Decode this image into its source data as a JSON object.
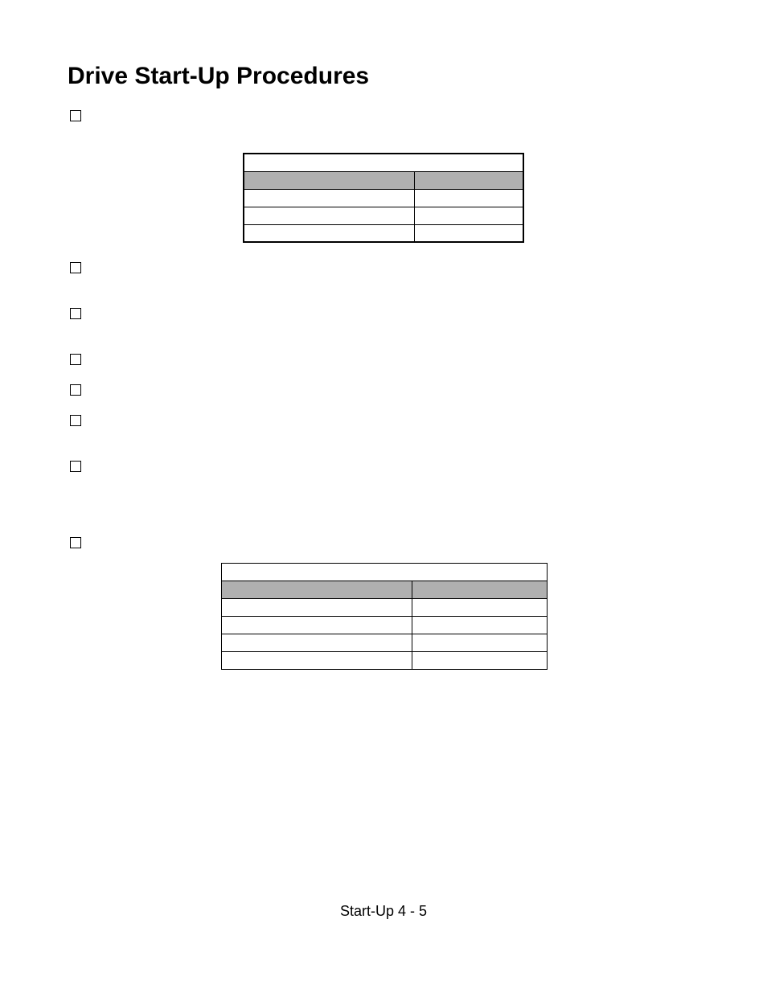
{
  "title": "Drive Start-Up Procedures",
  "footer": "Start-Up  4 - 5",
  "checkboxes": {
    "cb1": "",
    "cb2": "",
    "cb3": "",
    "cb4": "",
    "cb5": "",
    "cb6": "",
    "cb7": "",
    "cb8": ""
  },
  "table1": {
    "row1c1": "",
    "row1c2": "",
    "hdr_c1": "",
    "hdr_c2": "",
    "r2c1": "",
    "r2c2": "",
    "r3c1": "",
    "r3c2": "",
    "r4c1": "",
    "r4c2": ""
  },
  "table2": {
    "row1c1": "",
    "row1c2": "",
    "hdr_c1": "",
    "hdr_c2": "",
    "r2c1": "",
    "r2c2": "",
    "r3c1": "",
    "r3c2": "",
    "r4c1": "",
    "r4c2": "",
    "r5c1": "",
    "r5c2": ""
  }
}
